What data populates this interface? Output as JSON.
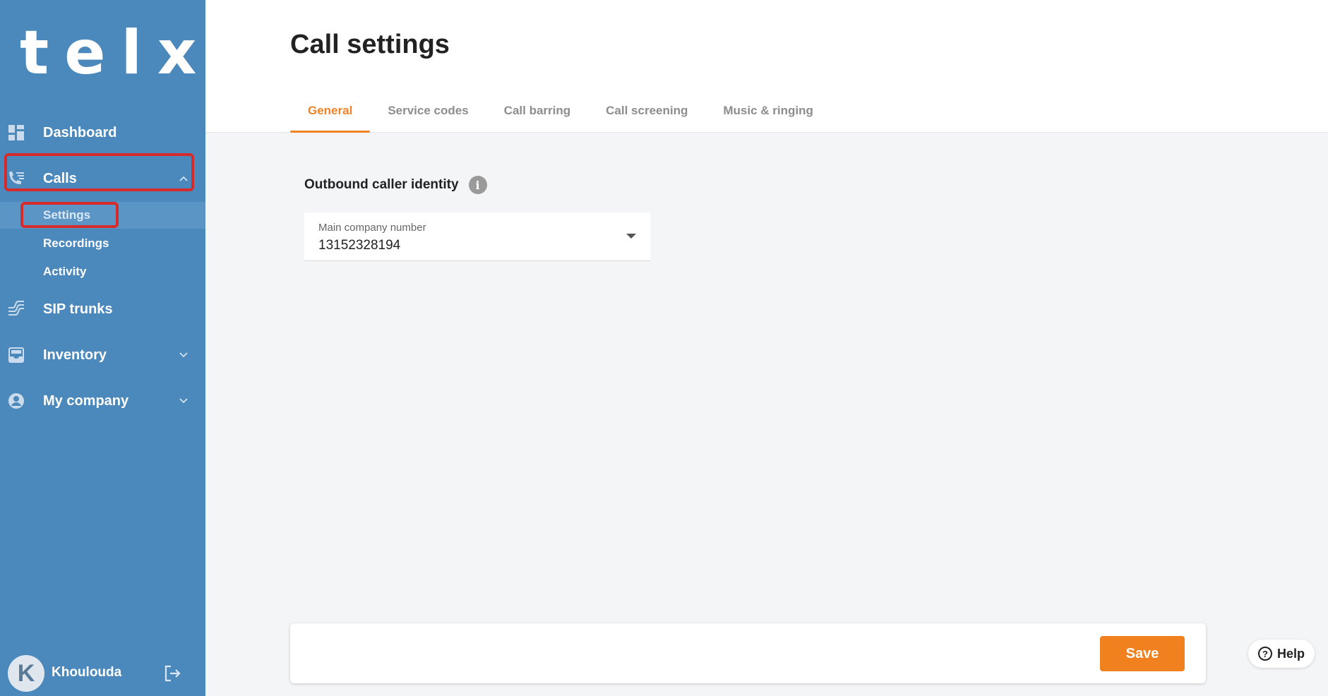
{
  "brand": {
    "logo_text": "telxi"
  },
  "sidebar": {
    "items": [
      {
        "label": "Dashboard",
        "icon": "dashboard-icon"
      },
      {
        "label": "Calls",
        "icon": "phone-list-icon",
        "expanded": true
      },
      {
        "label": "SIP trunks",
        "icon": "sip-trunk-icon"
      },
      {
        "label": "Inventory",
        "icon": "inventory-tray-icon"
      },
      {
        "label": "My company",
        "icon": "user-circle-icon"
      }
    ],
    "calls_subitems": [
      {
        "label": "Settings",
        "active": true
      },
      {
        "label": "Recordings"
      },
      {
        "label": "Activity"
      }
    ]
  },
  "user": {
    "avatar_initial": "K",
    "name": "Khoulouda"
  },
  "page": {
    "title": "Call settings",
    "tabs": [
      {
        "label": "General",
        "active": true
      },
      {
        "label": "Service codes"
      },
      {
        "label": "Call barring"
      },
      {
        "label": "Call screening"
      },
      {
        "label": "Music & ringing"
      }
    ],
    "section_title": "Outbound caller identity",
    "select": {
      "label": "Main company number",
      "value": "13152328194"
    }
  },
  "footer": {
    "save_label": "Save"
  },
  "help": {
    "label": "Help"
  },
  "colors": {
    "sidebar_bg": "#4b88bb",
    "accent_orange": "#f0811e",
    "highlight_red": "#d72b2b"
  }
}
